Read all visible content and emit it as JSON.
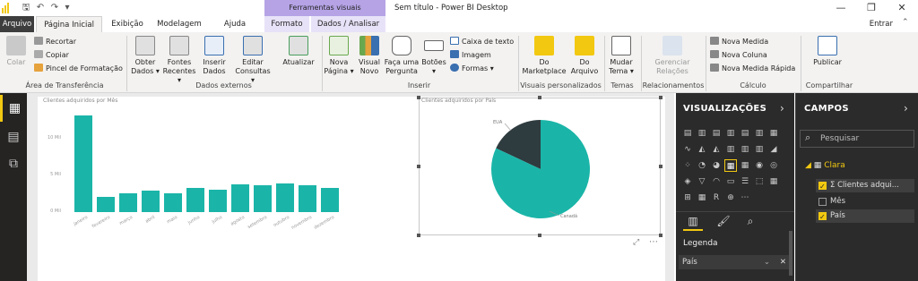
{
  "window": {
    "title": "Sem título - Power BI Desktop",
    "context_group": "Ferramentas visuais",
    "signin": "Entrar"
  },
  "tabs": [
    "Arquivo",
    "Página Inicial",
    "Exibição",
    "Modelagem",
    "Ajuda",
    "Formato",
    "Dados / Analisar"
  ],
  "ribbon": {
    "clipboard": {
      "paste": "Colar",
      "cut": "Recortar",
      "copy": "Copiar",
      "format_painter": "Pincel de Formatação",
      "label": "Área de Transferência"
    },
    "external": {
      "get_data": [
        "Obter",
        "Dados ▾"
      ],
      "recent_sources": [
        "Fontes",
        "Recentes ▾"
      ],
      "enter_data": [
        "Inserir",
        "Dados"
      ],
      "edit_queries": [
        "Editar",
        "Consultas ▾"
      ],
      "refresh": "Atualizar",
      "label": "Dados externos"
    },
    "insert": {
      "new_page": [
        "Nova",
        "Página ▾"
      ],
      "new_visual": [
        "Visual",
        "Novo"
      ],
      "ask_question": [
        "Faça uma",
        "Pergunta"
      ],
      "buttons": [
        "Botões",
        "▾"
      ],
      "textbox": "Caixa de texto",
      "image": "Imagem",
      "shapes": "Formas ▾",
      "label": "Inserir"
    },
    "custom_visuals": {
      "marketplace": [
        "Do",
        "Marketplace"
      ],
      "from_file": [
        "Do",
        "Arquivo"
      ],
      "label": "Visuais personalizados"
    },
    "themes": {
      "switch_theme": [
        "Mudar",
        "Tema ▾"
      ],
      "label": "Temas"
    },
    "relationships": {
      "manage": [
        "Gerenciar",
        "Relações"
      ],
      "label": "Relacionamentos"
    },
    "calculations": {
      "new_measure": "Nova Medida",
      "new_column": "Nova Coluna",
      "new_quick_measure": "Nova Medida Rápida",
      "label": "Cálculo"
    },
    "share": {
      "publish": "Publicar",
      "label": "Compartilhar"
    }
  },
  "bar_chart": {
    "title": "Clientes adquiridos por Mês",
    "y_ticks": [
      "10 Mil",
      "5 Mil",
      "0 Mil"
    ],
    "chart_data": {
      "type": "bar",
      "categories": [
        "janeiro",
        "fevereiro",
        "março",
        "abril",
        "maio",
        "junho",
        "julho",
        "agosto",
        "setembro",
        "outubro",
        "novembro",
        "dezembro"
      ],
      "values": [
        13100,
        2100,
        2600,
        2900,
        2600,
        3300,
        3000,
        3800,
        3600,
        3900,
        3600,
        3300
      ],
      "ylim": [
        0,
        14000
      ]
    }
  },
  "pie_chart": {
    "title": "Clientes adquiridos por País",
    "chart_data": {
      "type": "pie",
      "labels": [
        "EUA",
        "Canadá"
      ],
      "values": [
        18,
        82
      ]
    }
  },
  "viz_pane": {
    "title": "VISUALIZAÇÕES",
    "legend_label": "Legenda",
    "legend_field": "País"
  },
  "fields_pane": {
    "title": "CAMPOS",
    "search_placeholder": "Pesquisar",
    "table_name": "Clara",
    "fields": [
      {
        "label": "Σ Clientes adqui...",
        "checked": true
      },
      {
        "label": "Mês",
        "checked": false
      },
      {
        "label": "País",
        "checked": true
      }
    ]
  },
  "colors": {
    "accent": "#f2c811",
    "teal": "#1ab5a8",
    "dark_slice": "#2e3b3f",
    "pane_bg": "#2b2b2b"
  }
}
